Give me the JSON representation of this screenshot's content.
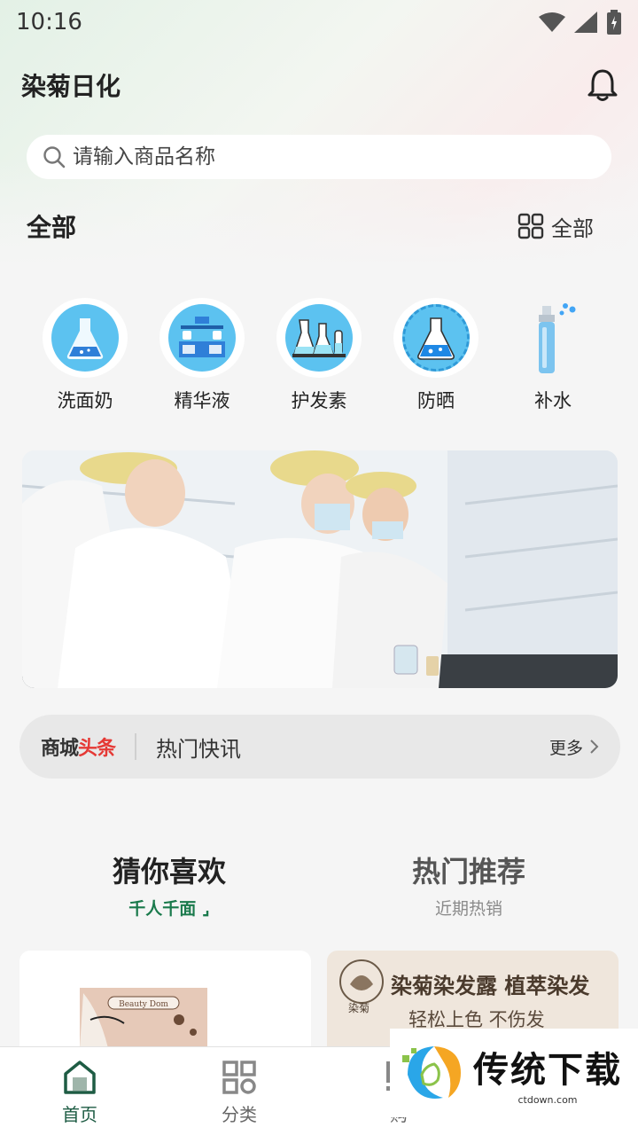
{
  "status_bar": {
    "time": "10:16"
  },
  "header": {
    "title": "染菊日化"
  },
  "search": {
    "placeholder": "请输入商品名称"
  },
  "section": {
    "title": "全部",
    "all_label": "全部"
  },
  "categories": [
    {
      "label": "洗面奶",
      "icon": "flask-icon"
    },
    {
      "label": "精华液",
      "icon": "lab-bench-icon"
    },
    {
      "label": "护发素",
      "icon": "beakers-icon"
    },
    {
      "label": "防晒",
      "icon": "chemistry-flask-icon"
    },
    {
      "label": "补水",
      "icon": "spray-bottle-icon"
    }
  ],
  "banner": {
    "image": "laboratory-workers-photo"
  },
  "news": {
    "brand_part1": "商城",
    "brand_part2": "头条",
    "text": "热门快讯",
    "more": "更多"
  },
  "recommend": {
    "tabs": [
      {
        "title": "猜你喜欢",
        "subtitle": "千人千面"
      },
      {
        "title": "热门推荐",
        "subtitle": "近期热销"
      }
    ]
  },
  "cards": {
    "right_title": "染菊染发露 植萃染发",
    "right_sub": "轻松上色 不伤发",
    "right_logo": "染菊"
  },
  "bottom_nav": [
    {
      "label": "首页",
      "icon": "home-icon"
    },
    {
      "label": "分类",
      "icon": "category-grid-icon"
    },
    {
      "label": "购",
      "icon": "cart-icon"
    }
  ],
  "watermark": {
    "main": "传统下载",
    "url": "ctdown.com"
  },
  "colors": {
    "accent": "#1a7a4c",
    "brand_red": "#e53935",
    "icon_blue": "#5cc2f0"
  }
}
